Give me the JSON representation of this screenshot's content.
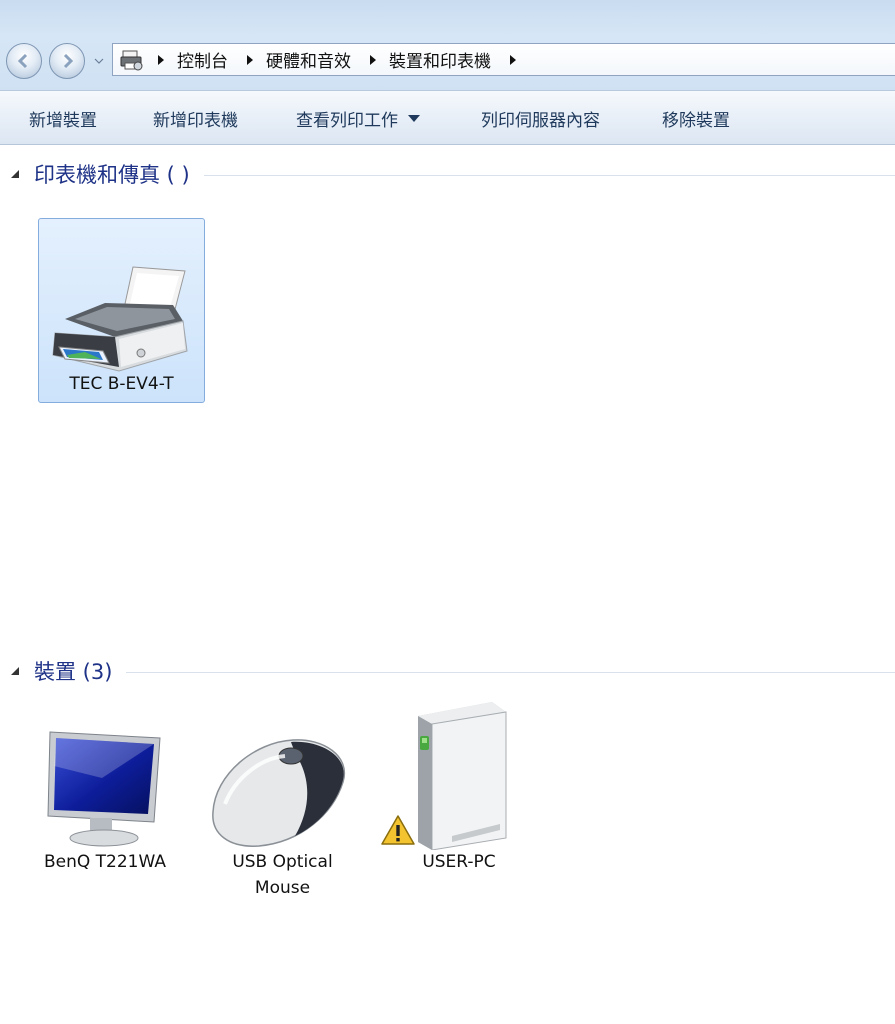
{
  "address": {
    "crumbs": [
      "控制台",
      "硬體和音效",
      "裝置和印表機"
    ]
  },
  "toolbar": {
    "add_device": "新增裝置",
    "add_printer": "新增印表機",
    "see_print_jobs": "查看列印工作",
    "print_server_props": "列印伺服器內容",
    "remove_device": "移除裝置"
  },
  "groups": {
    "printers": {
      "title": "印表機和傳真 (    )"
    },
    "devices": {
      "title": "裝置 (3)"
    }
  },
  "printers": [
    {
      "label": "TEC B-EV4-T",
      "icon": "printer-icon",
      "selected": true
    }
  ],
  "devices": [
    {
      "label": "BenQ T221WA",
      "icon": "monitor-icon"
    },
    {
      "label_line1": "USB Optical",
      "label_line2": "Mouse",
      "icon": "mouse-icon"
    },
    {
      "label": "USER-PC",
      "icon": "computer-tower-icon",
      "badge": "warning-icon"
    }
  ],
  "colors": {
    "group_title": "#1e3287",
    "toolbar_text": "#1e395b",
    "selection": "#cce3fb"
  }
}
